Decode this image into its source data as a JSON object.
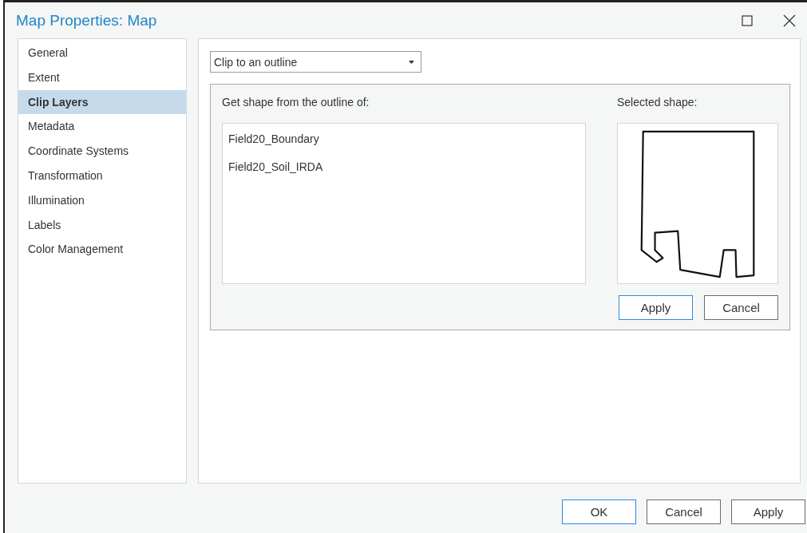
{
  "window": {
    "title": "Map Properties: Map"
  },
  "sidebar": {
    "items": [
      {
        "label": "General",
        "selected": false
      },
      {
        "label": "Extent",
        "selected": false
      },
      {
        "label": "Clip Layers",
        "selected": true
      },
      {
        "label": "Metadata",
        "selected": false
      },
      {
        "label": "Coordinate Systems",
        "selected": false
      },
      {
        "label": "Transformation",
        "selected": false
      },
      {
        "label": "Illumination",
        "selected": false
      },
      {
        "label": "Labels",
        "selected": false
      },
      {
        "label": "Color Management",
        "selected": false
      }
    ]
  },
  "clip_mode": {
    "value": "Clip to an outline"
  },
  "outline_group": {
    "list_label": "Get shape from the outline of:",
    "layers": [
      "Field20_Boundary",
      "Field20_Soil_IRDA"
    ],
    "preview_label": "Selected shape:",
    "buttons": [
      {
        "label": "Apply",
        "kind": "primary"
      },
      {
        "label": "Cancel",
        "kind": "normal"
      }
    ]
  },
  "footer_buttons": [
    {
      "label": "OK",
      "kind": "primary"
    },
    {
      "label": "Cancel",
      "kind": "normal"
    },
    {
      "label": "Apply",
      "kind": "normal"
    }
  ]
}
